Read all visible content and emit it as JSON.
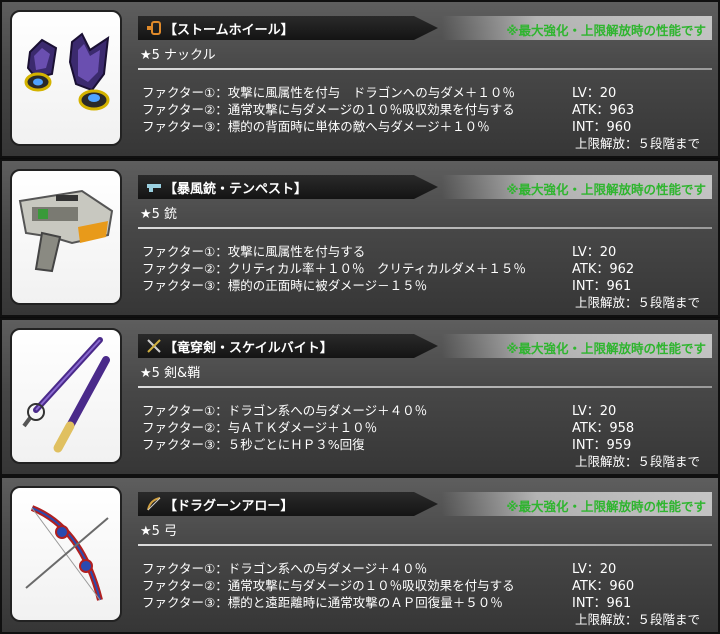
{
  "note": "※最大強化・上限解放時の性能です",
  "factor_labels": [
    "ファクター①：",
    "ファクター②：",
    "ファクター③："
  ],
  "stat_labels": {
    "lv": "LV：",
    "atk": "ATK：",
    "int": "INT："
  },
  "cards": [
    {
      "title": "【ストームホイール】",
      "type_icon": "knuckle-icon",
      "rarity": "★5 ナックル",
      "factors": [
        "攻撃に風属性を付与　ドラゴンへの与ダメ＋１０％",
        "通常攻撃に与ダメージの１０％吸収効果を付与する",
        "標的の背面時に単体の敵へ与ダメージ＋１０％"
      ],
      "lv": "20",
      "atk": "963",
      "int": "960",
      "limit": "上限解放：５段階まで"
    },
    {
      "title": "【暴風銃・テンペスト】",
      "type_icon": "gun-icon",
      "rarity": "★5 銃",
      "factors": [
        "攻撃に風属性を付与する",
        "クリティカル率＋１０％　クリティカルダメ＋１５％",
        "標的の正面時に被ダメージ－１５％"
      ],
      "lv": "20",
      "atk": "962",
      "int": "961",
      "limit": "上限解放：５段階まで"
    },
    {
      "title": "【竜穿剣・スケイルバイト】",
      "type_icon": "sword-icon",
      "rarity": "★5 剣&鞘",
      "factors": [
        "ドラゴン系への与ダメージ＋４０％",
        "与ＡＴＫダメージ＋１０％",
        "５秒ごとにＨＰ３%回復"
      ],
      "lv": "20",
      "atk": "958",
      "int": "959",
      "limit": "上限解放：５段階まで"
    },
    {
      "title": "【ドラグーンアロー】",
      "type_icon": "bow-icon",
      "rarity": "★5 弓",
      "factors": [
        "ドラゴン系への与ダメージ＋４０％",
        "通常攻撃に与ダメージの１０％吸収効果を付与する",
        "標的と遠距離時に通常攻撃のＡＰ回復量＋５０％"
      ],
      "lv": "20",
      "atk": "960",
      "int": "961",
      "limit": "上限解放：５段階まで"
    }
  ]
}
